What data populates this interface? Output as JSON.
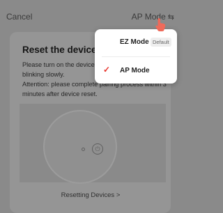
{
  "header": {
    "cancel_label": "Cancel",
    "mode_label": "AP Mode",
    "swap_icon": "⇆"
  },
  "card": {
    "title": "Reset the device firs",
    "line1": "Please turn on the device an",
    "line2": "blinking slowly.",
    "line3": "Attention: please complete pairing process within 3",
    "line4": "minutes after device reset."
  },
  "footer": {
    "resetting_label": "Resetting Devices >"
  },
  "menu": {
    "items": [
      {
        "label": "EZ Mode",
        "badge": "Default",
        "selected": false
      },
      {
        "label": "AP Mode",
        "selected": true
      }
    ]
  },
  "colors": {
    "accent": "#e8332a",
    "pointer": "#ee6a5a",
    "overlay": "#8a8a8a"
  }
}
